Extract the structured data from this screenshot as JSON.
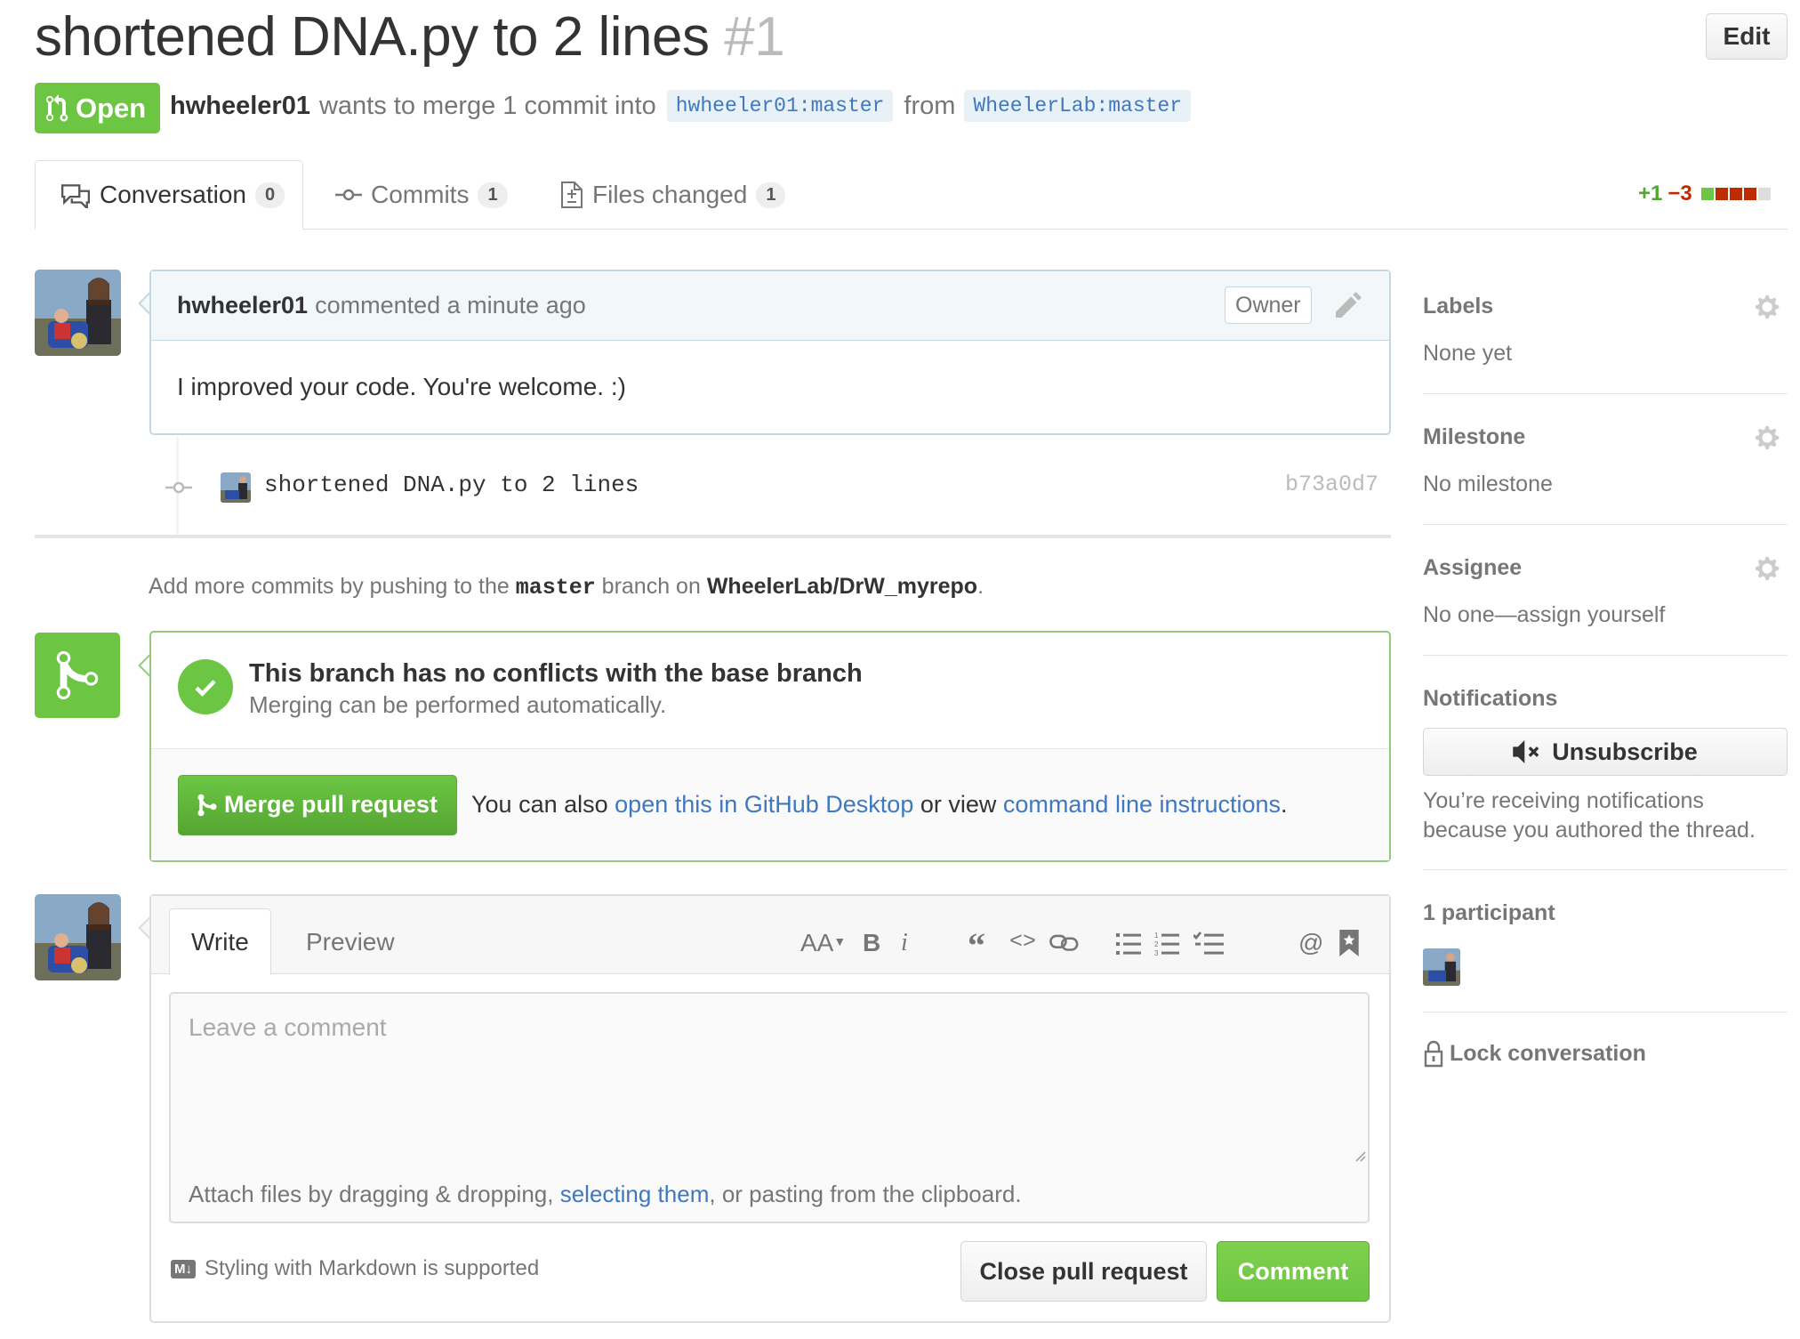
{
  "header": {
    "title": "shortened DNA.py to 2 lines",
    "number": "#1",
    "edit_label": "Edit",
    "state": "Open",
    "author": "hwheeler01",
    "merge_text": "wants to merge 1 commit into",
    "base_ref": "hwheeler01:master",
    "from_text": "from",
    "head_ref": "WheelerLab:master"
  },
  "tabs": [
    {
      "label": "Conversation",
      "count": "0"
    },
    {
      "label": "Commits",
      "count": "1"
    },
    {
      "label": "Files changed",
      "count": "1"
    }
  ],
  "diffstat": {
    "additions": "+1",
    "deletions": "−3",
    "colors": [
      "#6cc644",
      "#bd2c00",
      "#bd2c00",
      "#bd2c00",
      "#ddd"
    ]
  },
  "comment": {
    "author": "hwheeler01",
    "meta": "commented a minute ago",
    "badge": "Owner",
    "body": "I improved your code. You're welcome. :)"
  },
  "commit": {
    "message": "shortened DNA.py to 2 lines",
    "sha": "b73a0d7"
  },
  "push_hint": {
    "prefix": "Add more commits by pushing to the",
    "branch": "master",
    "middle": "branch on",
    "repo": "WheelerLab/DrW_myrepo",
    "suffix": "."
  },
  "merge": {
    "title": "This branch has no conflicts with the base branch",
    "subtitle": "Merging can be performed automatically.",
    "button": "Merge pull request",
    "text_prefix": "You can also",
    "desktop_link": "open this in GitHub Desktop",
    "text_middle": "or view",
    "cli_link": "command line instructions",
    "text_suffix": "."
  },
  "form": {
    "tab_write": "Write",
    "tab_preview": "Preview",
    "toolbar": {
      "heading": "AA",
      "bold": "B",
      "italic": "i",
      "quote": "“",
      "code": "<>",
      "at": "@"
    },
    "placeholder": "Leave a comment",
    "attach_prefix": "Attach files by dragging & dropping,",
    "attach_link": "selecting them",
    "attach_suffix": ", or pasting from the clipboard.",
    "markdown_hint": "Styling with Markdown is supported",
    "md_badge": "M↓",
    "close_button": "Close pull request",
    "comment_button": "Comment"
  },
  "sidebar": {
    "labels": {
      "heading": "Labels",
      "value": "None yet"
    },
    "milestone": {
      "heading": "Milestone",
      "value": "No milestone"
    },
    "assignee": {
      "heading": "Assignee",
      "value": "No one—assign yourself"
    },
    "notifications": {
      "heading": "Notifications",
      "button": "Unsubscribe",
      "reason": "You’re receiving notifications because you authored the thread."
    },
    "participants": {
      "heading": "1 participant"
    },
    "lock": "Lock conversation"
  },
  "colors": {
    "green": "#6cc644",
    "link": "#4078c0",
    "red": "#bd2c00"
  }
}
